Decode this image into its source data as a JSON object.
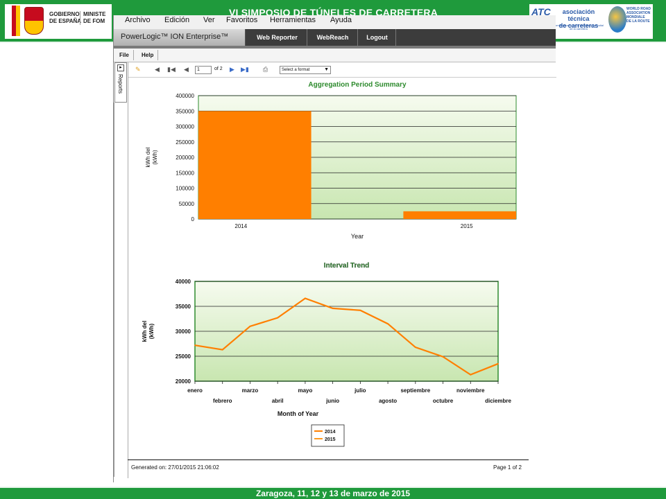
{
  "conference": {
    "title": "VI SIMPOSIO DE TÚNELES DE CARRETERA",
    "footer": "Zaragoza, 11, 12 y 13 de marzo de 2015",
    "left_logo": {
      "line1": "GOBIERNO",
      "line2": "DE ESPAÑA",
      "ministry1": "MINISTE",
      "ministry2": "DE FOM"
    },
    "right_logo": {
      "mark": "ATC",
      "name_line1": "asociación técnica",
      "name_line2": "de carreteras",
      "sub": "comité español de la asociación mundial de la carretera",
      "wra_line1": "WORLD ROAD",
      "wra_line2": "ASSOCIATION",
      "wra_line3": "MONDIALE",
      "wra_line4": "DE LA ROUTE"
    }
  },
  "browser": {
    "menu": [
      "Archivo",
      "Edición",
      "Ver",
      "Favoritos",
      "Herramientas",
      "Ayuda"
    ]
  },
  "app": {
    "brand": "PowerLogic™ ION Enterprise™",
    "nav": [
      "Web Reporter",
      "WebReach",
      "Logout"
    ],
    "toolbar": [
      "File",
      "Help"
    ],
    "side_tab": "Reports"
  },
  "viewer": {
    "page_value": "1",
    "of_pages": "of 2",
    "format_placeholder": "Select a format",
    "generated": "Generated on: 27/01/2015 21:06:02",
    "page_label": "Page 1 of 2"
  },
  "colors": {
    "series_2014": "#ff7f00",
    "series_2015": "#ff9a20",
    "plot_border": "#2e8b2e",
    "title_green": "#2d8a2d",
    "band_green": "#1f9a3c"
  },
  "chart_data": [
    {
      "type": "bar",
      "title": "Aggregation Period Summary",
      "xlabel": "Year",
      "ylabel": "kWh del (kWh)",
      "ylim": [
        0,
        400000
      ],
      "yticks": [
        "0",
        "50000",
        "100000",
        "150000",
        "200000",
        "250000",
        "300000",
        "350000",
        "400000"
      ],
      "categories": [
        "2014",
        "2015"
      ],
      "values": [
        350000,
        25000
      ],
      "grid": true
    },
    {
      "type": "line",
      "title": "Interval Trend",
      "xlabel": "Month of Year",
      "ylabel": "kWh del (kWh)",
      "ylim": [
        20000,
        40000
      ],
      "yticks": [
        "20000",
        "25000",
        "30000",
        "35000",
        "40000"
      ],
      "categories": [
        "enero",
        "febrero",
        "marzo",
        "abril",
        "mayo",
        "junio",
        "julio",
        "agosto",
        "septiembre",
        "octubre",
        "noviembre",
        "diciembre"
      ],
      "series": [
        {
          "name": "2014",
          "values": [
            27200,
            26300,
            31000,
            32700,
            36600,
            34600,
            34200,
            31500,
            26800,
            24900,
            21300,
            23500
          ]
        },
        {
          "name": "2015",
          "values": []
        }
      ],
      "legend_position": "bottom-left",
      "grid": true
    }
  ]
}
